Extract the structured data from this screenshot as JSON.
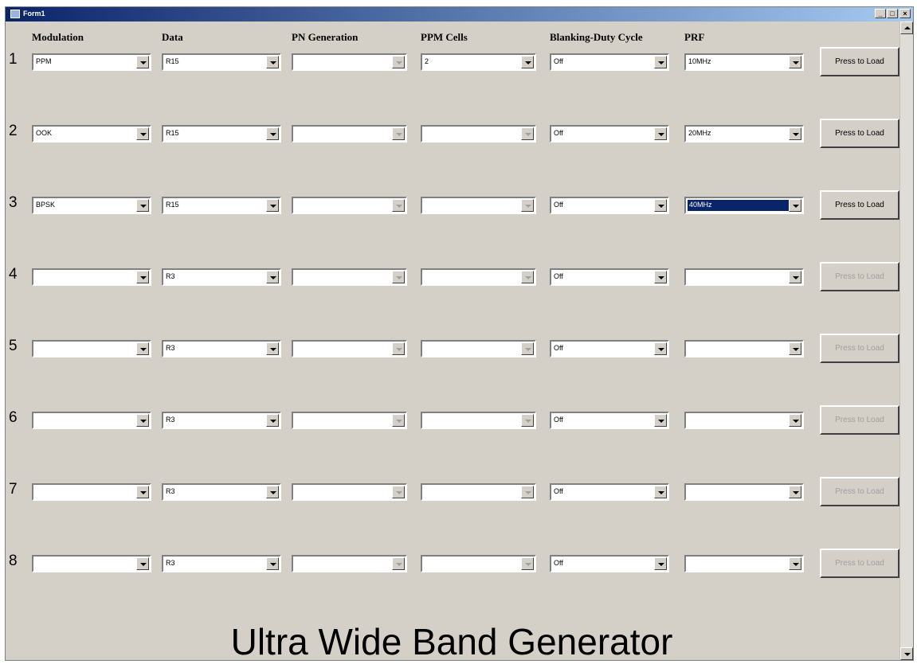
{
  "window": {
    "title": "Form1",
    "controls": {
      "minimize": "_",
      "maximize": "□",
      "close": "×"
    }
  },
  "columns": [
    "Modulation",
    "Data",
    "PN Generation",
    "PPM Cells",
    "Blanking-Duty Cycle",
    "PRF"
  ],
  "rows": [
    {
      "num": "1",
      "modulation": "PPM",
      "data": "R15",
      "pn": "",
      "ppm_cells": "2",
      "blanking": "Off",
      "prf": "10MHz",
      "button": "Press to Load",
      "button_enabled": true
    },
    {
      "num": "2",
      "modulation": "OOK",
      "data": "R15",
      "pn": "",
      "ppm_cells": "",
      "blanking": "Off",
      "prf": "20MHz",
      "button": "Press to Load",
      "button_enabled": true
    },
    {
      "num": "3",
      "modulation": "BPSK",
      "data": "R15",
      "pn": "",
      "ppm_cells": "",
      "blanking": "Off",
      "prf": "40MHz",
      "button": "Press to Load",
      "button_enabled": true,
      "prf_selected": true
    },
    {
      "num": "4",
      "modulation": "",
      "data": "R3",
      "pn": "",
      "ppm_cells": "",
      "blanking": "Off",
      "prf": "",
      "button": "Press to Load",
      "button_enabled": false
    },
    {
      "num": "5",
      "modulation": "",
      "data": "R3",
      "pn": "",
      "ppm_cells": "",
      "blanking": "Off",
      "prf": "",
      "button": "Press to Load",
      "button_enabled": false
    },
    {
      "num": "6",
      "modulation": "",
      "data": "R3",
      "pn": "",
      "ppm_cells": "",
      "blanking": "Off",
      "prf": "",
      "button": "Press to Load",
      "button_enabled": false
    },
    {
      "num": "7",
      "modulation": "",
      "data": "R3",
      "pn": "",
      "ppm_cells": "",
      "blanking": "Off",
      "prf": "",
      "button": "Press to Load",
      "button_enabled": false
    },
    {
      "num": "8",
      "modulation": "",
      "data": "R3",
      "pn": "",
      "ppm_cells": "",
      "blanking": "Off",
      "prf": "",
      "button": "Press to Load",
      "button_enabled": false
    }
  ],
  "footer_title": "Ultra Wide Band Generator",
  "colors": {
    "titlebar": "#0a246a",
    "face": "#d4d0c8",
    "selection": "#0a246a"
  }
}
